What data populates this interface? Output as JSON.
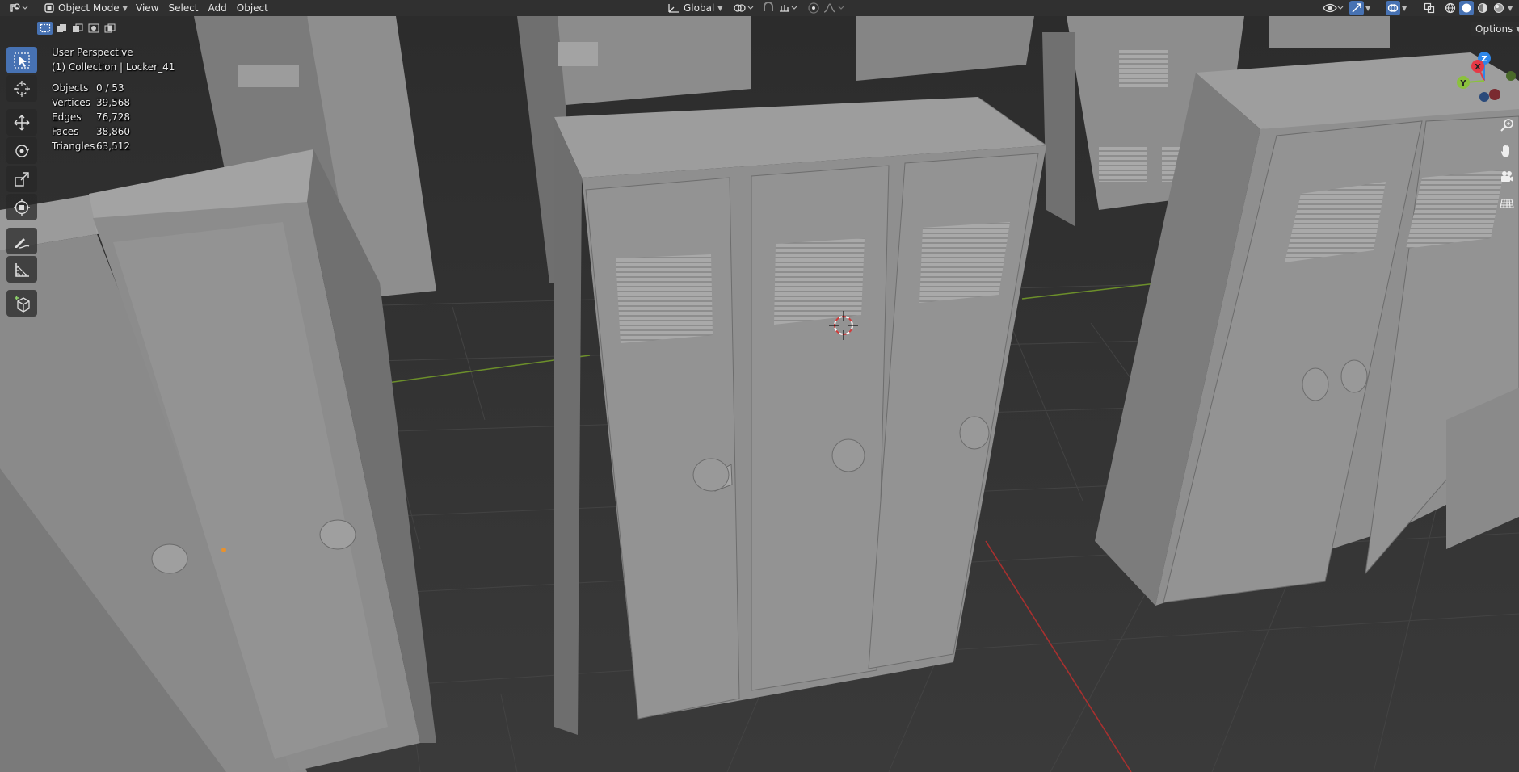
{
  "header": {
    "editor_type_icon": "viewport-editor-icon",
    "mode": {
      "label": "Object Mode",
      "icon": "object-mode-icon"
    },
    "menus": [
      "View",
      "Select",
      "Add",
      "Object"
    ],
    "transform_orientation": "Global",
    "pivot_icon": "pivot-icon",
    "snap_icon": "snap-icon",
    "proportional_icon": "proportional-edit-icon",
    "falloff_icon": "falloff-icon",
    "right_icons": [
      "visibility-icon",
      "gizmo-icon",
      "overlay-icon",
      "xray-icon",
      "wireframe-shading-icon",
      "solid-shading-icon",
      "material-shading-icon",
      "rendered-shading-icon"
    ]
  },
  "tool_header": {
    "select_modes": [
      "select-new-icon",
      "select-extend-icon",
      "select-subtract-icon",
      "select-invert-icon",
      "select-intersect-icon"
    ],
    "options_label": "Options"
  },
  "toolbar": {
    "tools": [
      "select-box-icon",
      "cursor-icon",
      "move-icon",
      "rotate-icon",
      "scale-icon",
      "transform-icon",
      "annotate-icon",
      "measure-icon",
      "add-cube-icon"
    ],
    "active": "select-box-icon"
  },
  "viewport": {
    "view_name": "User Perspective",
    "collection_label": "(1) Collection | Locker_41",
    "stats": [
      {
        "label": "Objects",
        "value": "0 / 53"
      },
      {
        "label": "Vertices",
        "value": "39,568"
      },
      {
        "label": "Edges",
        "value": "76,728"
      },
      {
        "label": "Faces",
        "value": "38,860"
      },
      {
        "label": "Triangles",
        "value": "63,512"
      }
    ]
  },
  "gizmo": {
    "x_label": "X",
    "y_label": "Y",
    "z_label": "Z",
    "x_color": "#e53946",
    "y_color": "#8bc13d",
    "z_color": "#2e86e8"
  },
  "nav_buttons": [
    "zoom-icon",
    "pan-hand-icon",
    "camera-view-icon",
    "ortho-grid-icon"
  ],
  "colors": {
    "active_blue": "#4772b3",
    "locker": "#8f8f8f",
    "floor": "#3a3a3a"
  }
}
